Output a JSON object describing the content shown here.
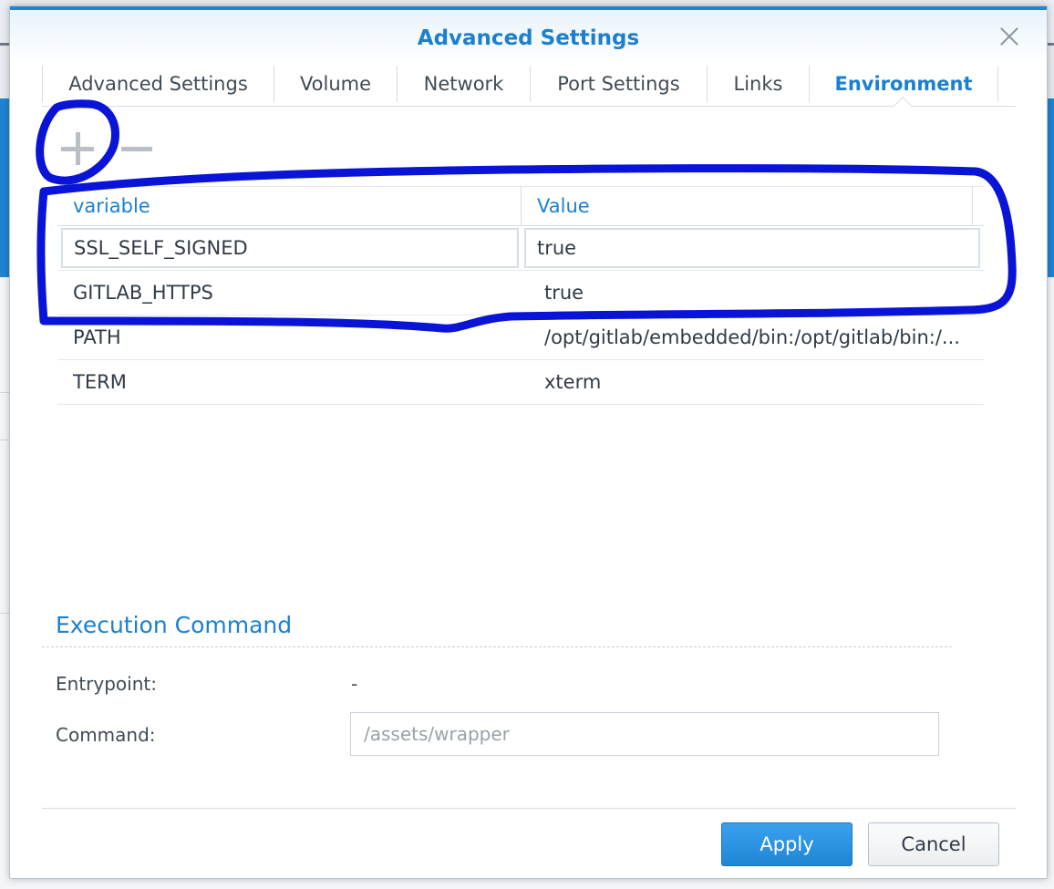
{
  "dialog": {
    "title": "Advanced Settings",
    "close_icon": "close-icon"
  },
  "tabs": [
    {
      "label": "Advanced Settings",
      "active": false
    },
    {
      "label": "Volume",
      "active": false
    },
    {
      "label": "Network",
      "active": false
    },
    {
      "label": "Port Settings",
      "active": false
    },
    {
      "label": "Links",
      "active": false
    },
    {
      "label": "Environment",
      "active": true
    }
  ],
  "toolbar": {
    "add_icon": "plus-icon",
    "remove_icon": "minus-icon"
  },
  "env_table": {
    "columns": [
      "variable",
      "Value"
    ],
    "rows": [
      {
        "variable": "SSL_SELF_SIGNED",
        "value": "true",
        "editing": true
      },
      {
        "variable": "GITLAB_HTTPS",
        "value": "true",
        "editing": false
      },
      {
        "variable": "PATH",
        "value": "/opt/gitlab/embedded/bin:/opt/gitlab/bin:/...",
        "editing": false
      },
      {
        "variable": "TERM",
        "value": "xterm",
        "editing": false
      }
    ]
  },
  "execution": {
    "title": "Execution Command",
    "entrypoint_label": "Entrypoint:",
    "entrypoint_value": "-",
    "command_label": "Command:",
    "command_placeholder": "/assets/wrapper"
  },
  "buttons": {
    "apply": "Apply",
    "cancel": "Cancel"
  },
  "colors": {
    "accent": "#1b80cf",
    "annotation": "#0a14d6"
  }
}
